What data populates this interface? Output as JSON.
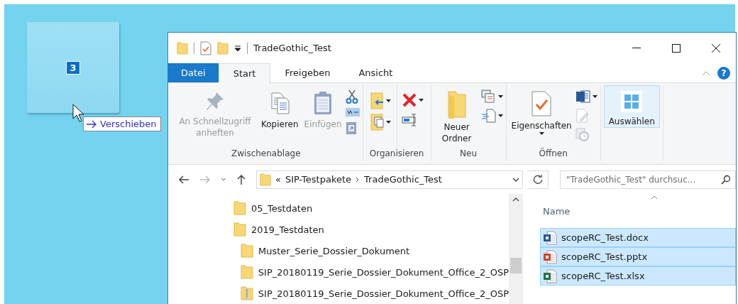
{
  "drag": {
    "count": "3",
    "tooltip": "Verschieben"
  },
  "window": {
    "title": "TradeGothic_Test",
    "help": "?"
  },
  "tabs": [
    {
      "label": "Datei",
      "kind": "file",
      "selected": false
    },
    {
      "label": "Start",
      "kind": "tab",
      "selected": true
    },
    {
      "label": "Freigeben",
      "kind": "tab",
      "selected": false
    },
    {
      "label": "Ansicht",
      "kind": "tab",
      "selected": false
    }
  ],
  "ribbon": [
    {
      "kind": "clipboard",
      "label": "Zwischenablage",
      "buttons": [
        {
          "label": "An Schnellzugriff anheften",
          "disabled": true
        },
        {
          "label": "Kopieren",
          "disabled": false
        },
        {
          "label": "Einfügen",
          "disabled": true
        }
      ]
    },
    {
      "kind": "organize",
      "label": "Organisieren"
    },
    {
      "kind": "new",
      "label": "Neu",
      "buttons": [
        {
          "label": "Neuer Ordner",
          "disabled": false
        }
      ]
    },
    {
      "kind": "open",
      "label": "Öffnen",
      "buttons": [
        {
          "label": "Eigenschaften",
          "disabled": false
        }
      ]
    },
    {
      "kind": "select",
      "buttons": [
        {
          "label": "Auswählen",
          "disabled": false,
          "pressed": true
        }
      ]
    }
  ],
  "address": {
    "overflow": "«",
    "path": [
      "SIP-Testpakete",
      "TradeGothic_Test"
    ]
  },
  "search": {
    "placeholder": "\"TradeGothic_Test\" durchsuc..."
  },
  "tree": [
    {
      "label": "05_Testdaten",
      "kind": "folder"
    },
    {
      "label": "2019_Testdaten",
      "kind": "folder",
      "children": [
        {
          "label": "Muster_Serie_Dossier_Dokument",
          "kind": "folder"
        },
        {
          "label": "SIP_20180119_Serie_Dossier_Dokument_Office_2_OSP",
          "kind": "folder"
        },
        {
          "label": "SIP_20180119_Serie_Dossier_Dokument_Office_2_OSP",
          "kind": "zip"
        }
      ]
    }
  ],
  "files": {
    "column": "Name",
    "rows": [
      {
        "name": "scopeRC_Test.docx",
        "kind": "docx",
        "selected": true
      },
      {
        "name": "scopeRC_Test.pptx",
        "kind": "pptx",
        "selected": true
      },
      {
        "name": "scopeRC_Test.xlsx",
        "kind": "xlsx",
        "selected": true
      }
    ]
  }
}
